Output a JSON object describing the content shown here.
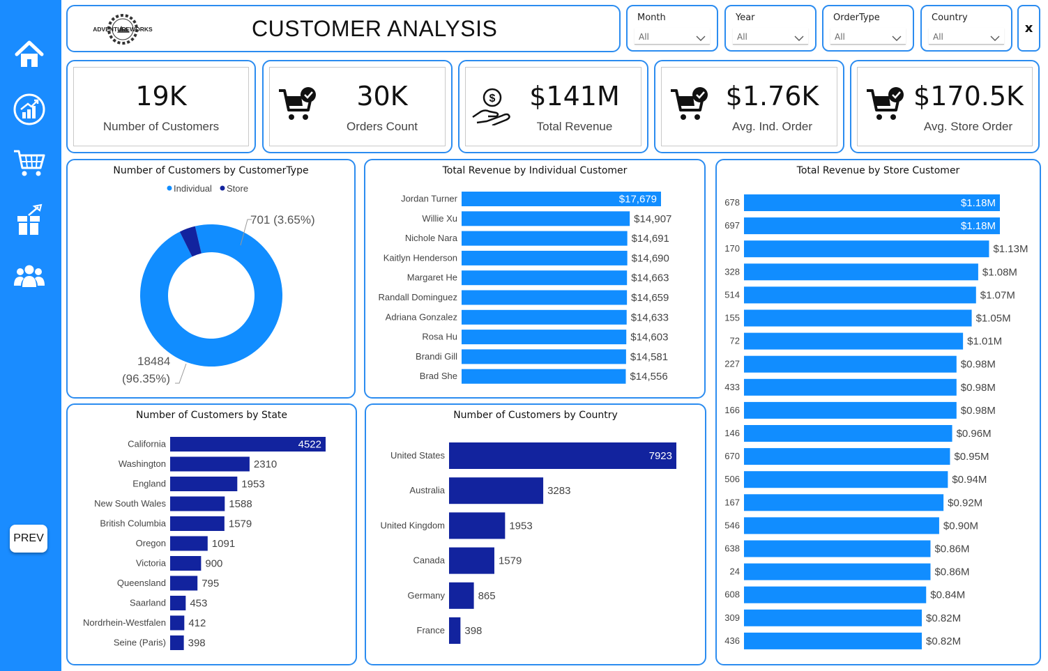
{
  "header": {
    "title": "CUSTOMER ANALYSIS",
    "logo_text": "ADVENTUREWORKS"
  },
  "slicers": [
    {
      "label": "Month",
      "value": "All"
    },
    {
      "label": "Year",
      "value": "All"
    },
    {
      "label": "OrderType",
      "value": "All"
    },
    {
      "label": "Country",
      "value": "All"
    }
  ],
  "clear_button": "x",
  "nav": {
    "prev_label": "PREV",
    "icons": [
      "home-icon",
      "sales-chart-icon",
      "cart-icon",
      "gift-icon",
      "users-icon"
    ]
  },
  "kpis": [
    {
      "value": "19K",
      "label": "Number of Customers",
      "icon": "none"
    },
    {
      "value": "30K",
      "label": "Orders Count",
      "icon": "cart-check-icon"
    },
    {
      "value": "$141M",
      "label": "Total Revenue",
      "icon": "money-hand-icon"
    },
    {
      "value": "$1.76K",
      "label": "Avg. Ind. Order",
      "icon": "cart-check-icon"
    },
    {
      "value": "$170.5K",
      "label": "Avg. Store Order",
      "icon": "cart-check-icon"
    }
  ],
  "colors": {
    "accent": "#1a8cff",
    "bar_light": "#118dff",
    "bar_dark": "#12239e",
    "border": "#2b8cf0"
  },
  "chart_data": [
    {
      "type": "pie",
      "title": "Number of Customers by CustomerType",
      "legend": [
        "Individual",
        "Store"
      ],
      "legend_position": "top",
      "categories": [
        "Individual",
        "Store"
      ],
      "values": [
        18484,
        701
      ],
      "data_labels": [
        "18484 (96.35%)",
        "701 (3.65%)"
      ],
      "label_lines": [
        "18484",
        "(96.35%)",
        "701 (3.65%)"
      ]
    },
    {
      "type": "bar",
      "title": "Total Revenue by Individual Customer",
      "categories": [
        "Jordan Turner",
        "Willie Xu",
        "Nichole Nara",
        "Kaitlyn Henderson",
        "Margaret He",
        "Randall Dominguez",
        "Adriana Gonzalez",
        "Rosa Hu",
        "Brandi Gill",
        "Brad She"
      ],
      "values": [
        17679,
        14907,
        14691,
        14690,
        14663,
        14659,
        14633,
        14603,
        14581,
        14556
      ],
      "data_labels": [
        "$17,679",
        "$14,907",
        "$14,691",
        "$14,690",
        "$14,663",
        "$14,659",
        "$14,633",
        "$14,603",
        "$14,581",
        "$14,556"
      ]
    },
    {
      "type": "bar",
      "title": "Total Revenue by Store Customer",
      "categories": [
        "678",
        "697",
        "170",
        "328",
        "514",
        "155",
        "72",
        "227",
        "433",
        "166",
        "146",
        "670",
        "506",
        "167",
        "546",
        "638",
        "24",
        "608",
        "309",
        "436"
      ],
      "values": [
        1.18,
        1.18,
        1.13,
        1.08,
        1.07,
        1.05,
        1.01,
        0.98,
        0.98,
        0.98,
        0.96,
        0.95,
        0.94,
        0.92,
        0.9,
        0.86,
        0.86,
        0.84,
        0.82,
        0.82
      ],
      "data_labels": [
        "$1.18M",
        "$1.18M",
        "$1.13M",
        "$1.08M",
        "$1.07M",
        "$1.05M",
        "$1.01M",
        "$0.98M",
        "$0.98M",
        "$0.98M",
        "$0.96M",
        "$0.95M",
        "$0.94M",
        "$0.92M",
        "$0.90M",
        "$0.86M",
        "$0.86M",
        "$0.84M",
        "$0.82M",
        "$0.82M"
      ]
    },
    {
      "type": "bar",
      "title": "Number of Customers by State",
      "categories": [
        "California",
        "Washington",
        "England",
        "New South Wales",
        "British Columbia",
        "Oregon",
        "Victoria",
        "Queensland",
        "Saarland",
        "Nordrhein-Westfalen",
        "Seine (Paris)"
      ],
      "values": [
        4522,
        2310,
        1953,
        1588,
        1579,
        1091,
        900,
        795,
        453,
        412,
        398
      ]
    },
    {
      "type": "bar",
      "title": "Number of Customers by Country",
      "categories": [
        "United States",
        "Australia",
        "United Kingdom",
        "Canada",
        "Germany",
        "France"
      ],
      "values": [
        7923,
        3283,
        1953,
        1579,
        865,
        398
      ]
    }
  ]
}
